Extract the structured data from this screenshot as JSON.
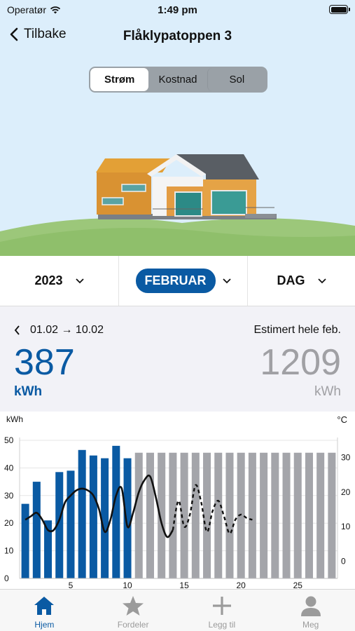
{
  "status": {
    "carrier": "Operatør",
    "time": "1:49 pm"
  },
  "nav": {
    "back_label": "Tilbake",
    "title": "Flåklypatoppen 3"
  },
  "segments": {
    "items": [
      "Strøm",
      "Kostnad",
      "Sol"
    ],
    "selected": "Strøm"
  },
  "selectors": {
    "year": "2023",
    "month": "FEBRUAR",
    "period": "DAG"
  },
  "summary": {
    "range": "01.02 → 10.02",
    "estimate_label": "Estimert hele feb.",
    "current_value": "387",
    "current_unit": "kWh",
    "estimate_value": "1209",
    "estimate_unit": "kWh"
  },
  "colors": {
    "accent": "#0a5aa3",
    "estimate_bar": "#a4a5aa",
    "hero_bg": "#dceefb",
    "grass": "#9cc77a"
  },
  "chart_data": {
    "type": "bar",
    "ylabel": "kWh",
    "y2label": "°C",
    "ylim": [
      0,
      50
    ],
    "y2lim": [
      -5,
      35
    ],
    "yticks": [
      0,
      10,
      20,
      30,
      40,
      50
    ],
    "y2ticks": [
      0,
      10,
      20,
      30
    ],
    "xticks": [
      5,
      10,
      15,
      20,
      25
    ],
    "days": [
      1,
      2,
      3,
      4,
      5,
      6,
      7,
      8,
      9,
      10,
      11,
      12,
      13,
      14,
      15,
      16,
      17,
      18,
      19,
      20,
      21,
      22,
      23,
      24,
      25,
      26,
      27,
      28
    ],
    "series": [
      {
        "kind": "actual",
        "days": [
          1,
          2,
          3,
          4,
          5,
          6,
          7,
          8,
          9,
          10
        ],
        "values": [
          27,
          35,
          21,
          38.5,
          39,
          46.5,
          44.5,
          43.5,
          48,
          43.5
        ]
      },
      {
        "kind": "estimate",
        "days": [
          11,
          12,
          13,
          14,
          15,
          16,
          17,
          18,
          19,
          20,
          21,
          22,
          23,
          24,
          25,
          26,
          27,
          28
        ],
        "values": [
          45.5,
          45.5,
          45.5,
          45.5,
          45.5,
          45.5,
          45.5,
          45.5,
          45.5,
          45.5,
          45.5,
          45.5,
          45.5,
          45.5,
          45.5,
          45.5,
          45.5,
          45.5
        ]
      }
    ],
    "temperature": {
      "actual": {
        "x": [
          1,
          1.5,
          2,
          2.5,
          3,
          3.5,
          4,
          4.5,
          5,
          5.5,
          6,
          6.5,
          7,
          7.5,
          8,
          8.5,
          9,
          9.5,
          10,
          10.5,
          11,
          11.5,
          12,
          12.5,
          13,
          13.5,
          14
        ],
        "y": [
          12,
          13,
          14,
          12,
          9,
          9,
          12,
          17,
          19,
          20.5,
          21,
          20.5,
          19,
          15,
          8.5,
          12,
          19,
          21,
          10,
          14,
          20,
          23.5,
          24.5,
          18.5,
          11,
          7,
          9
        ]
      },
      "forecast": {
        "x": [
          14,
          14.5,
          15,
          15.5,
          16,
          16.5,
          17,
          17.5,
          18,
          18.5,
          19,
          19.5,
          20,
          20.5,
          21
        ],
        "y": [
          9,
          17.5,
          10,
          13.5,
          22,
          17,
          8.5,
          14.5,
          17.5,
          13,
          8,
          12,
          13.5,
          12.5,
          12
        ]
      }
    }
  },
  "tabs": [
    {
      "label": "Hjem",
      "icon": "home-icon",
      "active": true
    },
    {
      "label": "Fordeler",
      "icon": "star-icon",
      "active": false
    },
    {
      "label": "Legg til",
      "icon": "plus-icon",
      "active": false
    },
    {
      "label": "Meg",
      "icon": "person-icon",
      "active": false
    }
  ]
}
